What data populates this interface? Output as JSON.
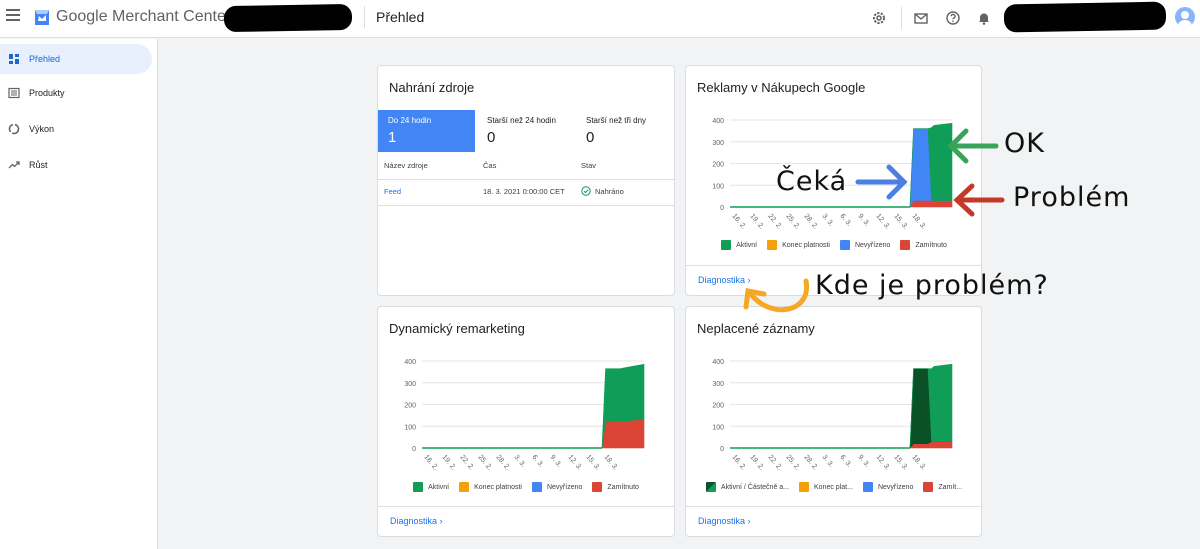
{
  "header": {
    "brand": "Google Merchant Center",
    "page_title": "Přehled",
    "icons": [
      "menu-icon",
      "merchant-logo-icon",
      "settings-icon",
      "mail-icon",
      "help-icon",
      "notifications-icon",
      "account-avatar"
    ]
  },
  "sidebar": {
    "items": [
      {
        "label": "Přehled",
        "icon": "dashboard-icon",
        "active": true
      },
      {
        "label": "Produkty",
        "icon": "list-icon"
      },
      {
        "label": "Výkon",
        "icon": "performance-icon"
      },
      {
        "label": "Růst",
        "icon": "trending-up-icon"
      }
    ]
  },
  "feed_card": {
    "title": "Nahrání zdroje",
    "tabs": [
      {
        "label": "Do 24 hodin",
        "count": "1"
      },
      {
        "label": "Starší než 24 hodin",
        "count": "0"
      },
      {
        "label": "Starší než tři dny",
        "count": "0"
      }
    ],
    "columns": [
      "Název zdroje",
      "Čas",
      "Stav"
    ],
    "rows": [
      {
        "name": "Feed",
        "time": "18. 3. 2021 0:00:00 CET",
        "status": "Nahráno"
      }
    ]
  },
  "ads_card": {
    "title": "Reklamy v Nákupech Google",
    "diag": "Diagnostika"
  },
  "remarketing_card": {
    "title": "Dynamický remarketing",
    "diag": "Diagnostika"
  },
  "free_card": {
    "title": "Neplacené záznamy",
    "diag": "Diagnostika"
  },
  "colors": {
    "green": "#0f9d58",
    "orange": "#f4a008",
    "blue": "#4285f4",
    "red": "#db4437",
    "dark_green": "#0b5127",
    "link": "#1a73e8"
  },
  "annotations": {
    "ok": "OK",
    "pending": "Čeká",
    "problem": "Problém",
    "where": "Kde je problém?",
    "colors": {
      "green_arrow": "#3aa35a",
      "blue_arrow": "#4b7fe0",
      "red_arrow": "#c23b2a",
      "orange_arrow": "#f4a824"
    }
  },
  "chart_data": [
    {
      "type": "area",
      "x": [
        "16. 2.",
        "19. 2.",
        "22. 2.",
        "25. 2.",
        "28. 2.",
        "3. 3.",
        "6. 3.",
        "9. 3.",
        "12. 3.",
        "15. 3.",
        "18. 3."
      ],
      "ylim": [
        0,
        400
      ],
      "yticks": [
        0,
        100,
        200,
        300,
        400
      ],
      "grid": true,
      "legend_position": "bottom",
      "legend": [
        "Aktivní",
        "Konec platnosti",
        "Nevyřízeno",
        "Zamítnuto"
      ],
      "series": [
        {
          "name": "Zamítnuto",
          "color": "#db4437",
          "x": [
            0,
            30,
            30.6,
            33,
            33.6,
            34,
            37
          ],
          "y": [
            0,
            0,
            30,
            30,
            30,
            30,
            30
          ]
        },
        {
          "name": "Nevyřízeno",
          "color": "#4285f4",
          "x": [
            0,
            30,
            30.6,
            33,
            33.6,
            34,
            37
          ],
          "y": [
            0,
            0,
            330,
            330,
            0,
            0,
            0
          ]
        },
        {
          "name": "Aktivní",
          "color": "#0f9d58",
          "x": [
            0,
            30,
            30.6,
            33,
            33.6,
            34,
            37
          ],
          "y": [
            0,
            0,
            0,
            0,
            335,
            345,
            355
          ]
        }
      ]
    },
    {
      "type": "area",
      "x": [
        "16. 2.",
        "19. 2.",
        "22. 2.",
        "25. 2.",
        "28. 2.",
        "3. 3.",
        "6. 3.",
        "9. 3.",
        "12. 3.",
        "15. 3.",
        "18. 3."
      ],
      "ylim": [
        0,
        400
      ],
      "yticks": [
        0,
        100,
        200,
        300,
        400
      ],
      "grid": true,
      "legend_position": "bottom",
      "legend": [
        "Aktivní",
        "Konec platnosti",
        "Nevyřízeno",
        "Zamítnuto"
      ],
      "series": [
        {
          "name": "Zamítnuto",
          "color": "#db4437",
          "x": [
            0,
            30,
            30.6,
            33,
            34,
            37
          ],
          "y": [
            0,
            0,
            120,
            125,
            125,
            133
          ]
        },
        {
          "name": "Aktivní",
          "color": "#0f9d58",
          "x": [
            0,
            30,
            30.6,
            33,
            34,
            37
          ],
          "y": [
            0,
            0,
            245,
            240,
            245,
            252
          ]
        }
      ]
    },
    {
      "type": "area",
      "x": [
        "16. 2.",
        "19. 2.",
        "22. 2.",
        "25. 2.",
        "28. 2.",
        "3. 3.",
        "6. 3.",
        "9. 3.",
        "12. 3.",
        "15. 3.",
        "18. 3."
      ],
      "ylim": [
        0,
        400
      ],
      "yticks": [
        0,
        100,
        200,
        300,
        400
      ],
      "grid": true,
      "legend_position": "bottom",
      "legend": [
        "Aktivní / Částečně a...",
        "Konec plat...",
        "Nevyřízeno",
        "Zamít..."
      ],
      "series": [
        {
          "name": "Zamítnuto",
          "color": "#db4437",
          "x": [
            0,
            30,
            30.6,
            33,
            33.6,
            34,
            37
          ],
          "y": [
            0,
            0,
            20,
            20,
            30,
            30,
            30
          ]
        },
        {
          "name": "Aktivní / Částečně a...",
          "color": "#0b5127",
          "x": [
            0,
            30,
            30.6,
            33,
            33.6,
            34,
            37
          ],
          "y": [
            0,
            0,
            345,
            345,
            0,
            0,
            0
          ]
        },
        {
          "name": "Aktivní",
          "color": "#0f9d58",
          "x": [
            0,
            30,
            30.6,
            33,
            33.6,
            34,
            37
          ],
          "y": [
            0,
            0,
            0,
            0,
            335,
            345,
            355
          ]
        }
      ]
    }
  ]
}
